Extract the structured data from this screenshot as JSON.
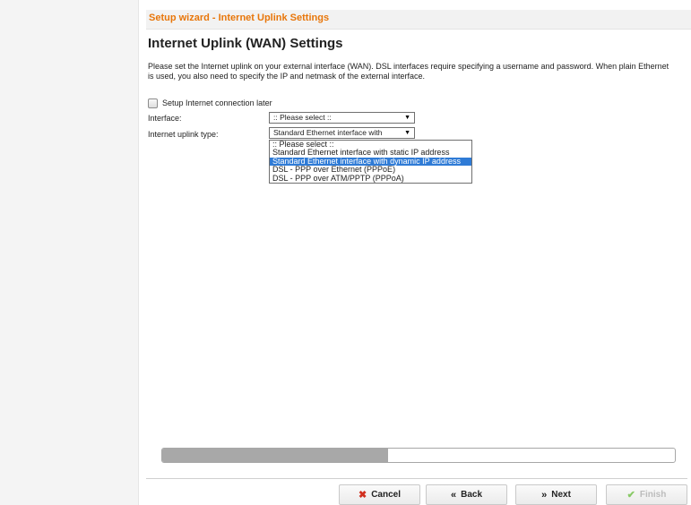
{
  "wizard": {
    "header": "Setup wizard - Internet Uplink Settings",
    "title": "Internet Uplink (WAN) Settings",
    "description": "Please set the Internet uplink on your external interface (WAN). DSL interfaces require specifying a username and password. When plain Ethernet is used, you also need to specify the IP and netmask of the external interface."
  },
  "form": {
    "setup_later_label": "Setup Internet connection later",
    "setup_later_checked": false,
    "interface_label": "Interface:",
    "interface_value": ":: Please select ::",
    "uplink_type_label": "Internet uplink type:",
    "uplink_type_value": "Standard Ethernet interface with",
    "uplink_type_options": [
      ":: Please select ::",
      "Standard Ethernet interface with static IP address",
      "Standard Ethernet interface with dynamic IP address",
      "DSL - PPP over Ethernet (PPPoE)",
      "DSL - PPP over ATM/PPTP (PPPoA)"
    ],
    "highlighted_option_index": 2
  },
  "progress": {
    "value_fraction": 0.44
  },
  "buttons": {
    "cancel": "Cancel",
    "back": "Back",
    "next": "Next",
    "finish": "Finish"
  },
  "icons": {
    "cancel": "x-icon",
    "back": "double-chevron-left-icon",
    "next": "double-chevron-right-icon",
    "finish": "checkmark-icon",
    "dropdown": "triangle-down-icon"
  },
  "colors": {
    "header_accent": "#e8760a",
    "selection": "#2f7bd6",
    "cancel_icon": "#d1301f",
    "finish_icon": "#5cb82a"
  }
}
